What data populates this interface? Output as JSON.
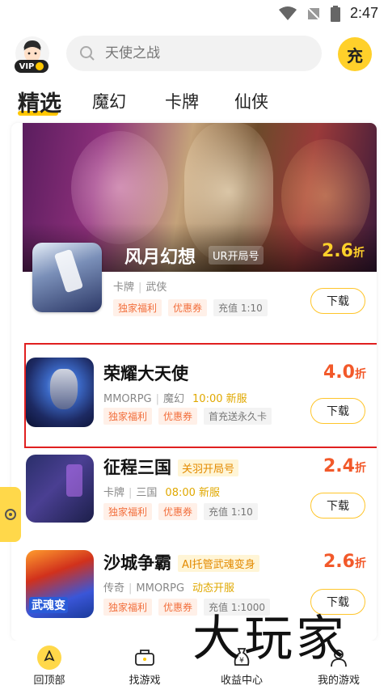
{
  "status_bar": {
    "time": "2:47"
  },
  "header": {
    "vip_label": "VIP",
    "search_placeholder": "天使之战",
    "recharge_label": "充"
  },
  "tabs": [
    {
      "label": "精选",
      "active": true
    },
    {
      "label": "魔幻",
      "active": false
    },
    {
      "label": "卡牌",
      "active": false
    },
    {
      "label": "仙侠",
      "active": false
    }
  ],
  "featured": {
    "title": "风月幻想",
    "server_tag": "UR开局号",
    "discount": "2.6",
    "discount_unit": "折",
    "meta_genre": "卡牌",
    "meta_theme": "武侠",
    "tags": [
      "独家福利",
      "优惠券",
      "充值 1:10"
    ],
    "download_label": "下载"
  },
  "games": [
    {
      "title": "荣耀大天使",
      "meta_genre": "MMORPG",
      "meta_theme": "魔幻",
      "time": "10:00 新服",
      "server_tag": "",
      "discount": "4.0",
      "discount_unit": "折",
      "tags": [
        "独家福利",
        "优惠券",
        "首充送永久卡"
      ],
      "download_label": "下载"
    },
    {
      "title": "征程三国",
      "meta_genre": "卡牌",
      "meta_theme": "三国",
      "time": "08:00 新服",
      "server_tag": "关羽开局号",
      "discount": "2.4",
      "discount_unit": "折",
      "tags": [
        "独家福利",
        "优惠券",
        "充值 1:10"
      ],
      "download_label": "下载"
    },
    {
      "title": "沙城争霸",
      "meta_genre": "传奇",
      "meta_theme": "MMORPG",
      "time": "动态开服",
      "server_tag": "AI托管武魂变身",
      "icon_text": "武魂变",
      "discount": "2.6",
      "discount_unit": "折",
      "tags": [
        "独家福利",
        "优惠券",
        "充值 1:1000"
      ],
      "download_label": "下载"
    }
  ],
  "bottom_nav": [
    {
      "label": "回顶部",
      "icon": "top-icon"
    },
    {
      "label": "找游戏",
      "icon": "gamepad-icon"
    },
    {
      "label": "收益中心",
      "icon": "money-bag-icon"
    },
    {
      "label": "我的游戏",
      "icon": "user-icon"
    }
  ],
  "watermark": "大玩家",
  "colors": {
    "accent": "#ffc700",
    "discount": "#f2592a",
    "tag_orange": "#f26f3d",
    "highlight": "#e02020"
  }
}
